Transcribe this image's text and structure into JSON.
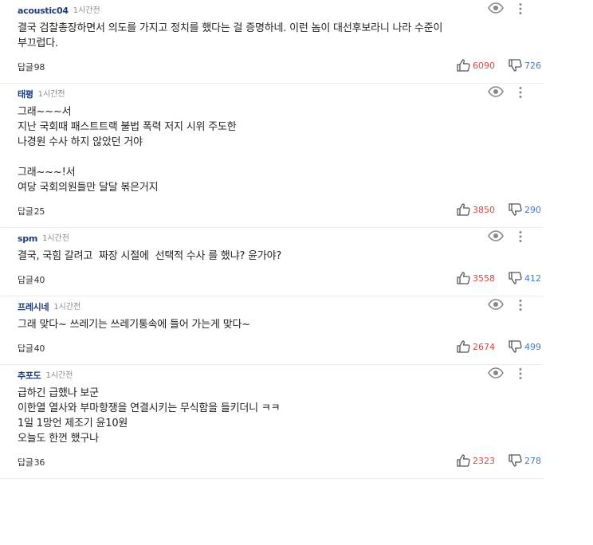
{
  "comments": [
    {
      "author": "acoustic04",
      "time": "1시간전",
      "body": "결국 검찰총장하면서 의도를 가지고 정치를 했다는 걸 증명하네. 이런 놈이 대선후보라니 나라 수준이\n부끄럽다.",
      "reply_label": "답글",
      "reply_count": "98",
      "likes": "6090",
      "dislikes": "726"
    },
    {
      "author": "태평",
      "time": "1시간전",
      "body": "그래~~~서\n지난 국회때 패스트트랙 불법 폭력 저지 시위 주도한\n나경원 수사 하지 않았던 거야\n\n그래~~~!서\n여당 국회의원들만 달달 볶은거지",
      "reply_label": "답글",
      "reply_count": "25",
      "likes": "3850",
      "dislikes": "290"
    },
    {
      "author": "spm",
      "time": "1시간전",
      "body": "결국, 국힘 갈려고  짜장 시절에  선택적 수사 를 했냐? 윤가야?",
      "reply_label": "답글",
      "reply_count": "40",
      "likes": "3558",
      "dislikes": "412"
    },
    {
      "author": "프레시네",
      "time": "1시간전",
      "body": "그래 맞다~ 쓰레기는 쓰레기통속에 들어 가는게 맞다~",
      "reply_label": "답글",
      "reply_count": "40",
      "likes": "2674",
      "dislikes": "499"
    },
    {
      "author": "추포도",
      "time": "1시간전",
      "body": "급하긴 급했나 보군\n이한열 열사와 부마항쟁을 연결시키는 무식함을 들키더니 ㅋㅋ\n1일 1망언 제조기 윤10원\n오늘도 한껀 했구나",
      "reply_label": "답글",
      "reply_count": "36",
      "likes": "2323",
      "dislikes": "278"
    }
  ],
  "icons": {
    "view": "eye-icon",
    "more": "more-vertical-icon",
    "like": "thumbs-up-icon",
    "dislike": "thumbs-down-icon"
  },
  "colors": {
    "author": "#1e3c7a",
    "like": "#e0443a",
    "dislike": "#4a74c9"
  }
}
